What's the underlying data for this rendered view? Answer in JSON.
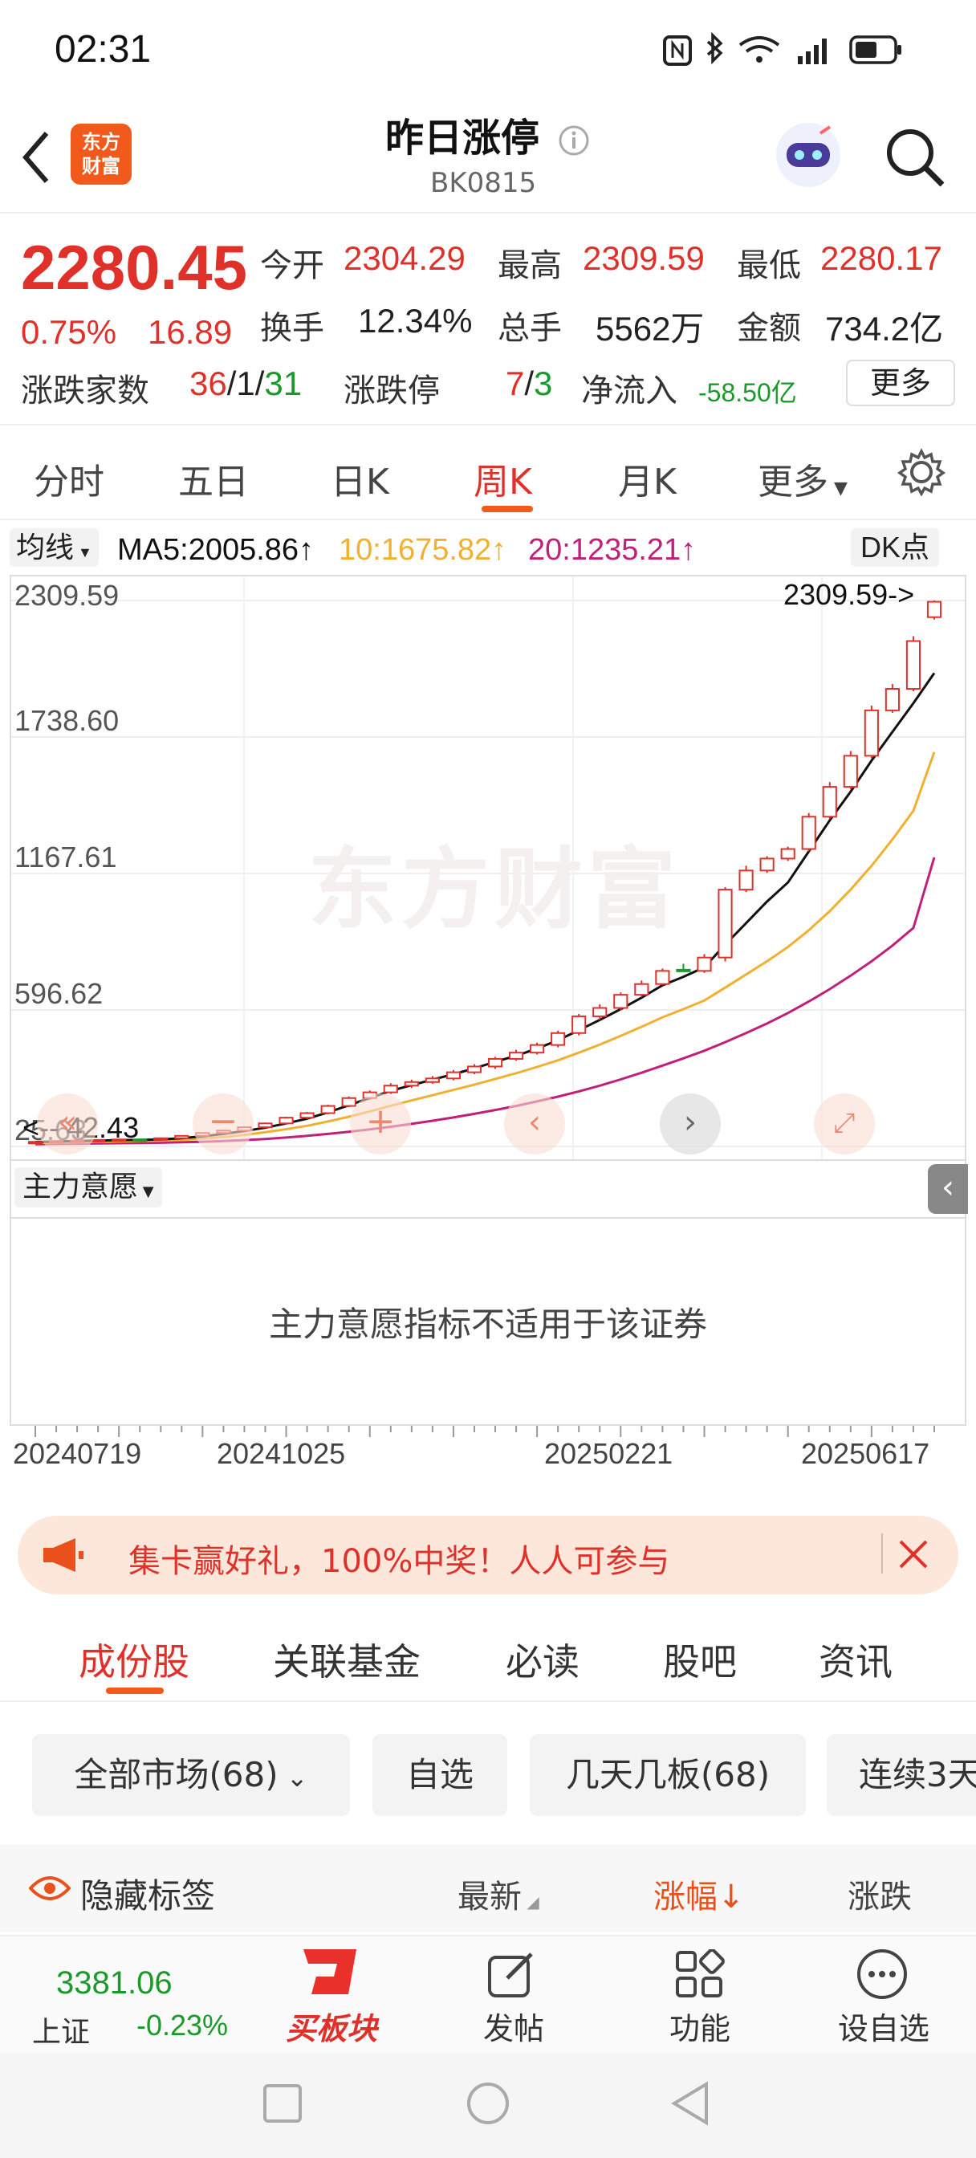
{
  "status_bar": {
    "time": "02:31"
  },
  "header": {
    "title": "昨日涨停",
    "code": "BK0815",
    "logo_line1": "东方",
    "logo_line2": "财富"
  },
  "quote": {
    "price": "2280.45",
    "change_pct": "0.75%",
    "change": "16.89",
    "open_label": "今开",
    "open": "2304.29",
    "high_label": "最高",
    "high": "2309.59",
    "low_label": "最低",
    "low": "2280.17",
    "turnover_label": "换手",
    "turnover": "12.34%",
    "volume_label": "总手",
    "volume": "5562万",
    "amount_label": "金额",
    "amount": "734.2亿",
    "breadth_label": "涨跌家数",
    "up": "36",
    "flat": "1",
    "down": "31",
    "limit_label": "涨跌停",
    "limit_up": "7",
    "limit_down": "3",
    "netflow_label": "净流入",
    "netflow": "-58.50亿",
    "more_label": "更多"
  },
  "chart_tabs": [
    {
      "label": "分时"
    },
    {
      "label": "五日"
    },
    {
      "label": "日K"
    },
    {
      "label": "周K"
    },
    {
      "label": "月K"
    },
    {
      "label": "更多"
    }
  ],
  "ma_bar": {
    "selector": "均线",
    "ma5": "MA5:2005.86↑",
    "ma10": "10:1675.82↑",
    "ma20": "20:1235.21↑",
    "dk": "DK点"
  },
  "colors": {
    "up": "#e0302a",
    "down": "#1a9a2a",
    "ma5": "#111111",
    "ma10": "#f0b030",
    "ma20": "#c0207a",
    "accent": "#f25a1b"
  },
  "chart_data": {
    "type": "candlestick",
    "y_ticks": [
      "2309.59",
      "1738.60",
      "1167.61",
      "596.62",
      "25.63"
    ],
    "ylim": [
      25.63,
      2309.59
    ],
    "max_marker": "2309.59->",
    "min_marker": "<-- 42.43",
    "x_ticks": [
      "20240719",
      "20241025",
      "20250221",
      "20250617"
    ],
    "candles": [
      [
        42,
        46,
        40,
        45
      ],
      [
        45,
        50,
        43,
        48
      ],
      [
        48,
        52,
        46,
        50
      ],
      [
        50,
        55,
        48,
        53
      ],
      [
        53,
        57,
        50,
        55
      ],
      [
        55,
        58,
        52,
        54
      ],
      [
        54,
        62,
        53,
        60
      ],
      [
        60,
        72,
        58,
        70
      ],
      [
        70,
        84,
        68,
        82
      ],
      [
        82,
        96,
        78,
        92
      ],
      [
        92,
        110,
        90,
        106
      ],
      [
        106,
        126,
        103,
        122
      ],
      [
        122,
        150,
        118,
        146
      ],
      [
        146,
        170,
        140,
        165
      ],
      [
        165,
        200,
        160,
        195
      ],
      [
        195,
        235,
        190,
        228
      ],
      [
        228,
        260,
        220,
        252
      ],
      [
        252,
        290,
        245,
        280
      ],
      [
        280,
        305,
        270,
        295
      ],
      [
        295,
        320,
        288,
        310
      ],
      [
        310,
        345,
        302,
        336
      ],
      [
        336,
        370,
        328,
        360
      ],
      [
        360,
        400,
        350,
        392
      ],
      [
        392,
        430,
        384,
        418
      ],
      [
        418,
        460,
        410,
        450
      ],
      [
        450,
        510,
        440,
        500
      ],
      [
        500,
        580,
        490,
        570
      ],
      [
        570,
        620,
        555,
        605
      ],
      [
        605,
        670,
        595,
        660
      ],
      [
        660,
        720,
        650,
        705
      ],
      [
        705,
        770,
        700,
        760
      ],
      [
        765,
        790,
        760,
        764
      ],
      [
        760,
        830,
        752,
        816
      ],
      [
        816,
        1110,
        800,
        1100
      ],
      [
        1100,
        1200,
        1090,
        1180
      ],
      [
        1180,
        1240,
        1170,
        1230
      ],
      [
        1230,
        1280,
        1220,
        1270
      ],
      [
        1270,
        1420,
        1260,
        1405
      ],
      [
        1405,
        1550,
        1395,
        1530
      ],
      [
        1530,
        1680,
        1520,
        1660
      ],
      [
        1660,
        1870,
        1650,
        1850
      ],
      [
        1850,
        1960,
        1840,
        1940
      ],
      [
        1940,
        2160,
        1930,
        2140
      ],
      [
        2240,
        2309.59,
        2230,
        2304.29
      ]
    ],
    "ma5": [
      44,
      46,
      48,
      50,
      52,
      53,
      55,
      60,
      68,
      78,
      90,
      104,
      122,
      142,
      168,
      198,
      228,
      258,
      282,
      305,
      328,
      352,
      380,
      405,
      435,
      470,
      512,
      555,
      600,
      648,
      700,
      735,
      775,
      870,
      960,
      1050,
      1130,
      1260,
      1390,
      1510,
      1640,
      1760,
      1880,
      2005.86
    ],
    "ma10": [
      40,
      42,
      43,
      45,
      46,
      48,
      50,
      53,
      58,
      65,
      74,
      85,
      98,
      112,
      130,
      150,
      172,
      196,
      218,
      240,
      262,
      284,
      308,
      332,
      358,
      386,
      418,
      452,
      488,
      526,
      566,
      600,
      636,
      690,
      745,
      800,
      860,
      930,
      1010,
      1100,
      1200,
      1310,
      1430,
      1675.82
    ],
    "ma20": [
      35,
      36,
      37,
      38,
      39,
      40,
      41,
      43,
      45,
      48,
      52,
      57,
      63,
      70,
      78,
      87,
      97,
      108,
      120,
      133,
      147,
      162,
      178,
      195,
      214,
      234,
      256,
      280,
      306,
      334,
      364,
      394,
      426,
      462,
      500,
      540,
      584,
      632,
      684,
      740,
      800,
      866,
      940,
      1235.21
    ]
  },
  "panel": {
    "selector": "主力意愿",
    "message": "主力意愿指标不适用于该证券"
  },
  "watermark": "东方财富",
  "banner": {
    "text": "集卡赢好礼，100%中奖！人人可参与"
  },
  "section_tabs": [
    {
      "label": "成份股"
    },
    {
      "label": "关联基金"
    },
    {
      "label": "必读"
    },
    {
      "label": "股吧"
    },
    {
      "label": "资讯"
    }
  ],
  "chips": [
    {
      "label": "全部市场(68)"
    },
    {
      "label": "自选"
    },
    {
      "label": "几天几板(68)"
    },
    {
      "label": "连续3天"
    }
  ],
  "list_header": {
    "hide_tags": "隐藏标签",
    "latest": "最新",
    "change_pct": "涨幅",
    "change": "涨跌"
  },
  "index": {
    "value": "3381.06",
    "name": "上证",
    "change": "-0.23%"
  },
  "bottom_nav": [
    {
      "label": "买板块"
    },
    {
      "label": "发帖"
    },
    {
      "label": "功能"
    },
    {
      "label": "设自选"
    }
  ]
}
